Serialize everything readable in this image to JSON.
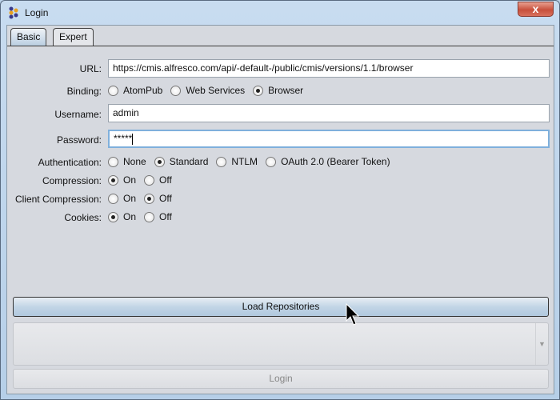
{
  "window": {
    "title": "Login",
    "close_label": "x"
  },
  "tabs": [
    {
      "label": "Basic",
      "active": true
    },
    {
      "label": "Expert",
      "active": false
    }
  ],
  "form": {
    "url": {
      "label": "URL:",
      "value": "https://cmis.alfresco.com/api/-default-/public/cmis/versions/1.1/browser"
    },
    "binding": {
      "label": "Binding:",
      "options": [
        "AtomPub",
        "Web Services",
        "Browser"
      ],
      "selected": "Browser"
    },
    "username": {
      "label": "Username:",
      "value": "admin"
    },
    "password": {
      "label": "Password:",
      "value": "*****"
    },
    "authentication": {
      "label": "Authentication:",
      "options": [
        "None",
        "Standard",
        "NTLM",
        "OAuth 2.0 (Bearer Token)"
      ],
      "selected": "Standard"
    },
    "compression": {
      "label": "Compression:",
      "options": [
        "On",
        "Off"
      ],
      "selected": "On"
    },
    "client_compression": {
      "label": "Client Compression:",
      "options": [
        "On",
        "Off"
      ],
      "selected": "Off"
    },
    "cookies": {
      "label": "Cookies:",
      "options": [
        "On",
        "Off"
      ],
      "selected": "On"
    }
  },
  "buttons": {
    "load": "Load Repositories",
    "login": "Login"
  }
}
